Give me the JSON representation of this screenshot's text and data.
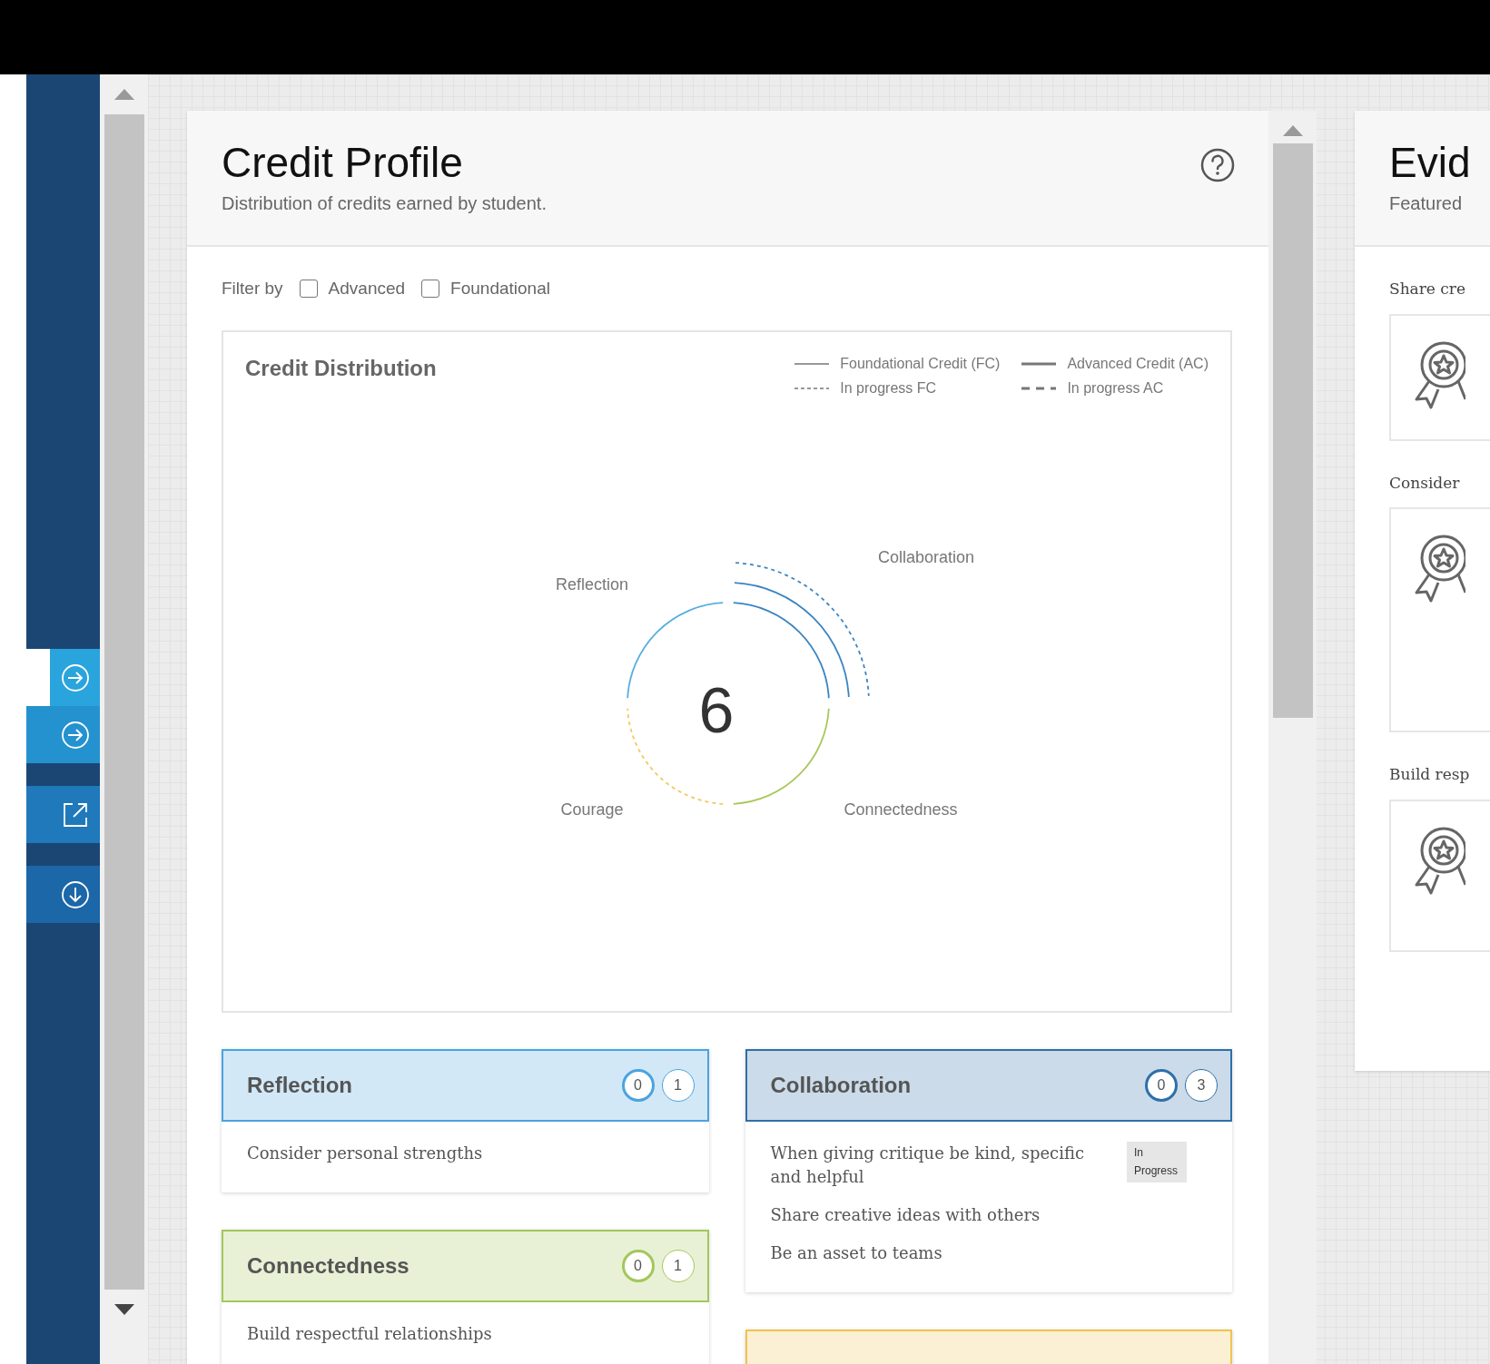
{
  "sidebar": {
    "buttons": [
      {
        "kind": "arrow",
        "selected": true,
        "color": "#2aa4dd"
      },
      {
        "kind": "arrow",
        "selected": false,
        "color": "#2492cf"
      },
      {
        "kind": "external",
        "selected": false,
        "color": "#1f79ba"
      },
      {
        "kind": "download",
        "selected": false,
        "color": "#1b67a8"
      }
    ]
  },
  "credit_profile": {
    "title": "Credit Profile",
    "subtitle": "Distribution of credits earned by student.",
    "filter": {
      "label": "Filter by",
      "options": [
        {
          "label": "Advanced",
          "checked": false
        },
        {
          "label": "Foundational",
          "checked": false
        }
      ]
    },
    "chart": {
      "title": "Credit Distribution",
      "legend": [
        {
          "label": "Foundational Credit (FC)",
          "dashed": false,
          "thick": false
        },
        {
          "label": "Advanced Credit (AC)",
          "dashed": false,
          "thick": true
        },
        {
          "label": "In progress FC",
          "dashed": true,
          "thick": false
        },
        {
          "label": "In progress AC",
          "dashed": true,
          "thick": true
        }
      ],
      "total": "6",
      "segments": [
        {
          "label": "Reflection",
          "color": "#58aee0",
          "credits": [
            {
              "in_progress": false
            }
          ]
        },
        {
          "label": "Collaboration",
          "color": "#3b85c2",
          "credits": [
            {
              "in_progress": false
            },
            {
              "in_progress": false
            },
            {
              "in_progress": true
            }
          ]
        },
        {
          "label": "Connectedness",
          "color": "#a9c85a",
          "credits": [
            {
              "in_progress": false
            }
          ]
        },
        {
          "label": "Courage",
          "color": "#f2c95b",
          "credits": [
            {
              "in_progress": true
            }
          ]
        }
      ]
    },
    "card_columns": [
      [
        {
          "title": "Reflection",
          "color": "#4aa3df",
          "advanced_count": "0",
          "foundational_count": "1",
          "items": [
            {
              "text": "Consider personal strengths"
            }
          ]
        },
        {
          "title": "Connectedness",
          "color": "#a3c75a",
          "advanced_count": "0",
          "foundational_count": "1",
          "items": [
            {
              "text": "Build respectful relationships"
            }
          ]
        }
      ],
      [
        {
          "title": "Collaboration",
          "color": "#2e6fa8",
          "advanced_count": "0",
          "foundational_count": "3",
          "items": [
            {
              "text": "When giving critique be kind, specific and helpful",
              "status": "In Progress"
            },
            {
              "text": "Share creative ideas with others"
            },
            {
              "text": "Be an asset to teams"
            }
          ]
        },
        {
          "color": "#f1c24e"
        }
      ]
    ]
  },
  "evidence": {
    "title": "Evid",
    "subtitle": "Featured",
    "sections": [
      {
        "label": "Share cre"
      },
      {
        "label": "Consider"
      },
      {
        "label": "Build resp"
      }
    ]
  }
}
